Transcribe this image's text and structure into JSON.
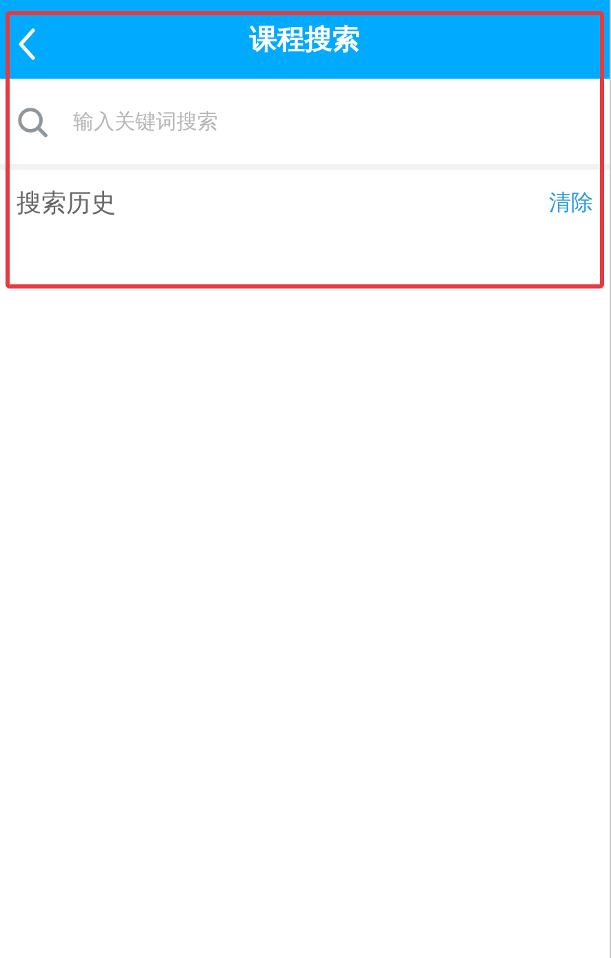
{
  "header": {
    "title": "课程搜索"
  },
  "search": {
    "placeholder": "输入关键词搜索"
  },
  "history": {
    "title": "搜索历史",
    "clear_label": "清除"
  },
  "highlight": {
    "color": "#e8393f"
  }
}
